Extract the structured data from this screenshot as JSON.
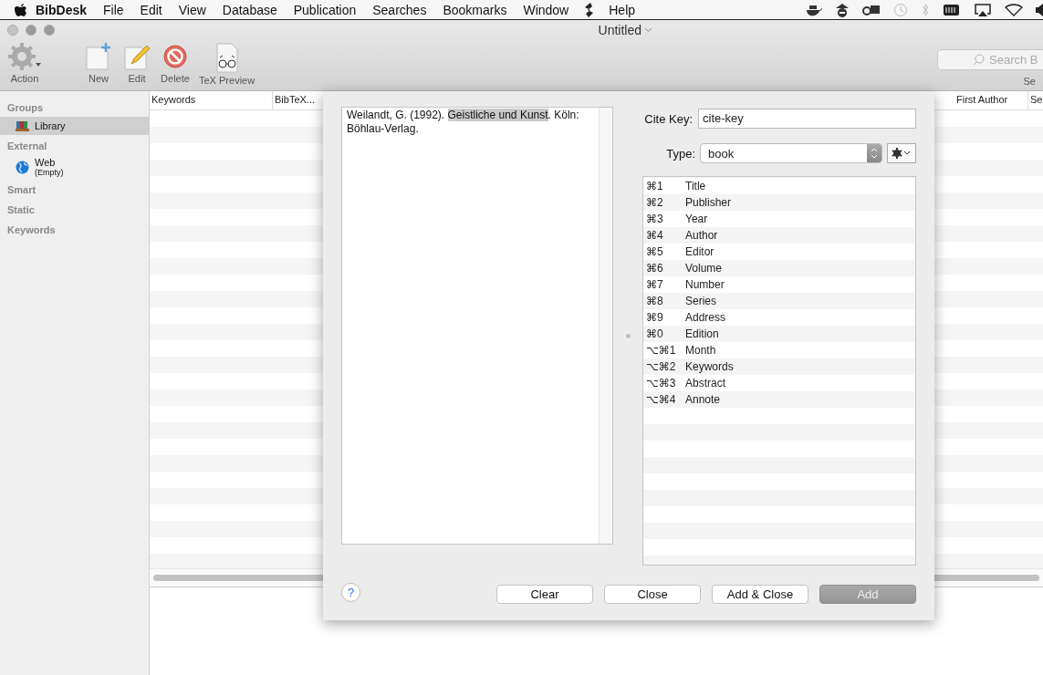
{
  "menu_bar": {
    "app_name": "BibDesk",
    "menus": [
      "File",
      "Edit",
      "View",
      "Database",
      "Publication",
      "Searches",
      "Bookmarks",
      "Window"
    ],
    "help": "Help"
  },
  "window": {
    "title": "Untitled"
  },
  "toolbar": {
    "items": [
      {
        "kind": "action",
        "label": "Action"
      },
      {
        "kind": "new",
        "label": "New"
      },
      {
        "kind": "edit",
        "label": "Edit"
      },
      {
        "kind": "delete",
        "label": "Delete"
      },
      {
        "kind": "tex",
        "label": "TeX Preview"
      }
    ],
    "search": {
      "placeholder": "Search B",
      "label": "Se"
    }
  },
  "sidebar": {
    "sections": [
      {
        "title": "Groups",
        "items": [
          {
            "kind": "library",
            "label": "Library",
            "selected": true
          }
        ]
      },
      {
        "title": "External",
        "items": [
          {
            "kind": "web",
            "label": "Web",
            "sublabel": "(Empty)",
            "selected": false
          }
        ]
      },
      {
        "title": "Smart"
      },
      {
        "title": "Static"
      },
      {
        "title": "Keywords"
      }
    ]
  },
  "table": {
    "columns": [
      "Keywords",
      "BibTeX...",
      "First Author",
      "Se"
    ]
  },
  "dialog": {
    "citation": [
      {
        "text": "Weilandt, G. (1992). ",
        "selected": false
      },
      {
        "text": "Geistliche und Kunst",
        "selected": true
      },
      {
        "text": ". Köln: Böhlau-Verlag.",
        "selected": false
      }
    ],
    "cite_key": {
      "label": "Cite Key:",
      "value": "cite-key"
    },
    "type": {
      "label": "Type:",
      "value": "book"
    },
    "fields": [
      {
        "shortcut": "⌘1",
        "name": "Title"
      },
      {
        "shortcut": "⌘2",
        "name": "Publisher"
      },
      {
        "shortcut": "⌘3",
        "name": "Year"
      },
      {
        "shortcut": "⌘4",
        "name": "Author"
      },
      {
        "shortcut": "⌘5",
        "name": "Editor"
      },
      {
        "shortcut": "⌘6",
        "name": "Volume"
      },
      {
        "shortcut": "⌘7",
        "name": "Number"
      },
      {
        "shortcut": "⌘8",
        "name": "Series"
      },
      {
        "shortcut": "⌘9",
        "name": "Address"
      },
      {
        "shortcut": "⌘0",
        "name": "Edition"
      },
      {
        "shortcut": "⌥⌘1",
        "name": "Month"
      },
      {
        "shortcut": "⌥⌘2",
        "name": "Keywords"
      },
      {
        "shortcut": "⌥⌘3",
        "name": "Abstract"
      },
      {
        "shortcut": "⌥⌘4",
        "name": "Annote"
      }
    ],
    "help": "?",
    "buttons": [
      {
        "label": "Clear",
        "default": false
      },
      {
        "label": "Close",
        "default": false
      },
      {
        "label": "Add & Close",
        "default": false
      },
      {
        "label": "Add",
        "default": true
      }
    ]
  }
}
